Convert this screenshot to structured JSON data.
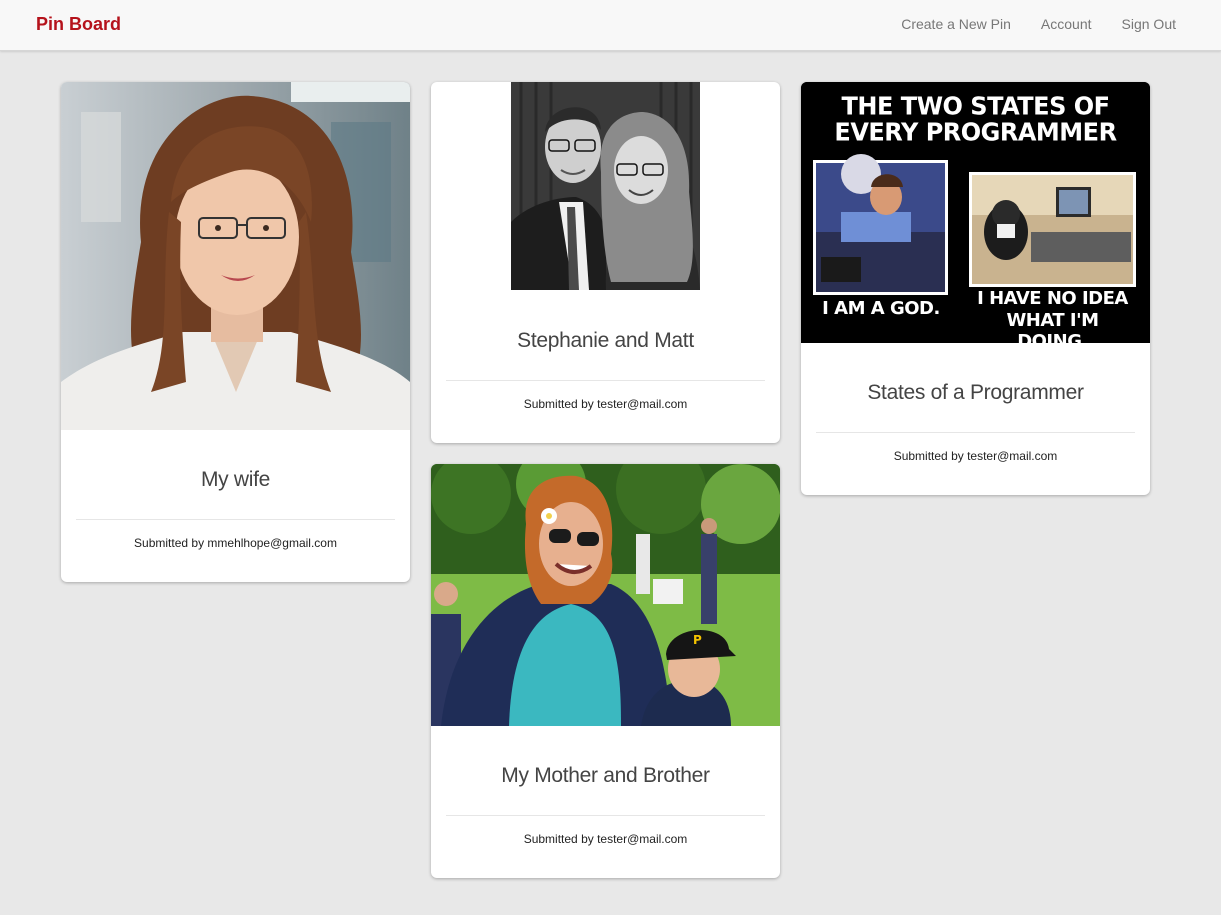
{
  "navbar": {
    "brand": "Pin Board",
    "links": [
      {
        "label": "Create a New Pin"
      },
      {
        "label": "Account"
      },
      {
        "label": "Sign Out"
      }
    ]
  },
  "pins": [
    {
      "title": "My wife",
      "submitted_by": "Submitted by mmehlhope@gmail.com"
    },
    {
      "title": "Stephanie and Matt",
      "submitted_by": "Submitted by tester@mail.com"
    },
    {
      "title": "My Mother and Brother",
      "submitted_by": "Submitted by tester@mail.com"
    },
    {
      "title": "States of a Programmer",
      "submitted_by": "Submitted by tester@mail.com",
      "image_text": {
        "heading_line1": "THE TWO STATES OF",
        "heading_line2": "EVERY PROGRAMMER",
        "left_caption": "I AM A GOD.",
        "right_caption_line1": "I HAVE NO IDEA",
        "right_caption_line2": "WHAT I'M DOING."
      }
    }
  ],
  "colors": {
    "brand": "#b5121b",
    "background": "#e8e8e8",
    "card": "#ffffff"
  }
}
